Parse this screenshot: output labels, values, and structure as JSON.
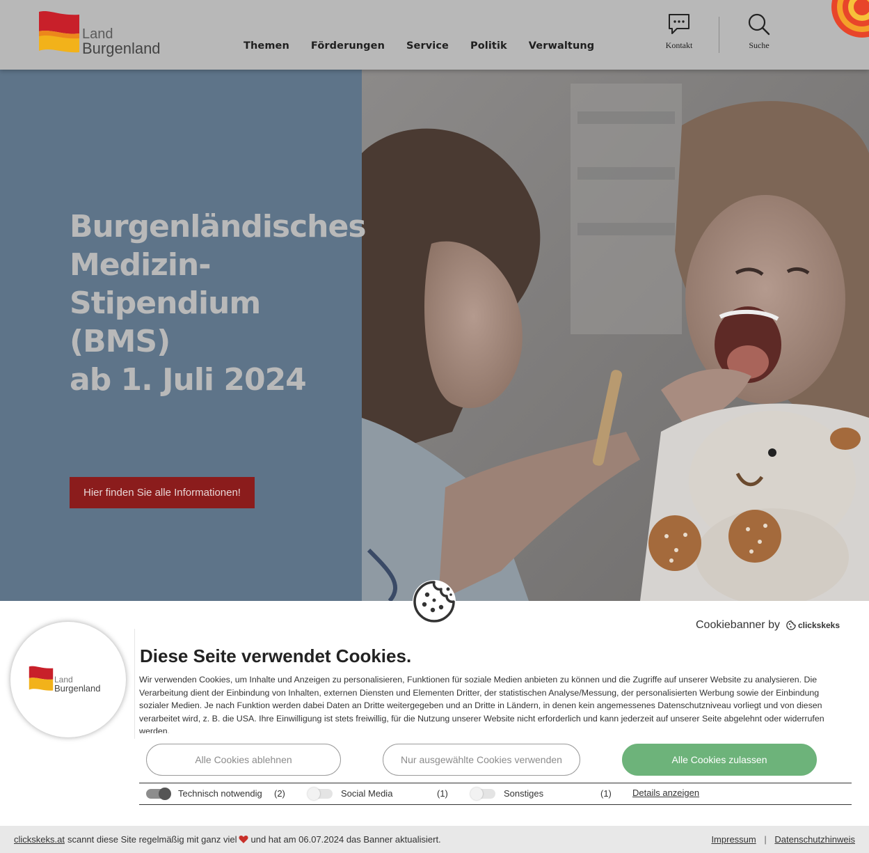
{
  "header": {
    "logo": {
      "line1": "Land",
      "line2": "Burgenland"
    },
    "nav": [
      "Themen",
      "Förderungen",
      "Service",
      "Politik",
      "Verwaltung"
    ],
    "contact_label": "Kontakt",
    "search_label": "Suche"
  },
  "hero": {
    "title_lines": [
      "Burgenländisches",
      "Medizin-",
      "Stipendium",
      "(BMS)",
      "ab 1. Juli 2024"
    ],
    "cta_label": "Hier finden Sie alle Informationen!"
  },
  "cookie_banner": {
    "byline": "Cookiebanner by",
    "brand": "clickskeks",
    "logo": {
      "line1": "Land",
      "line2": "Burgenland"
    },
    "title": "Diese Seite verwendet Cookies.",
    "text": "Wir verwenden Cookies, um Inhalte und Anzeigen zu personalisieren, Funktionen für soziale Medien anbieten zu können und die Zugriffe auf unserer Website zu analysieren. Die Verarbeitung dient der Einbindung von Inhalten, externen Diensten und Elementen Dritter, der statistischen Analyse/Messung, der personalisierten Werbung sowie der Einbindung sozialer Medien. Je nach Funktion werden dabei Daten an Dritte weitergegeben und an Dritte in Ländern, in denen kein angemessenes Datenschutzniveau vorliegt und von diesen verarbeitet wird, z. B. die USA. Ihre Einwilligung ist stets freiwillig, für die Nutzung unserer Website nicht erforderlich und kann jederzeit auf unserer Seite abgelehnt oder widerrufen werden.",
    "buttons": {
      "decline": "Alle Cookies ablehnen",
      "selected": "Nur ausgewählte Cookies verwenden",
      "accept": "Alle Cookies zulassen"
    },
    "categories": [
      {
        "label": "Technisch notwendig",
        "count": "(2)",
        "enabled": true
      },
      {
        "label": "Social Media",
        "count": "(1)",
        "enabled": false
      },
      {
        "label": "Sonstiges",
        "count": "(1)",
        "enabled": false
      }
    ],
    "details_label": "Details anzeigen"
  },
  "footer": {
    "site_link": "clickskeks.at",
    "text_before_heart": "scannt diese Site regelmäßig mit ganz viel",
    "text_after_heart": "und hat am 06.07.2024 das Banner aktualisiert.",
    "impressum": "Impressum",
    "separator": "|",
    "privacy": "Datenschutzhinweis"
  },
  "colors": {
    "header_bg": "#b8b8b8",
    "hero_bg": "#5e7489",
    "cta_bg": "#8b1c1c",
    "accept_green": "#6db37a"
  }
}
